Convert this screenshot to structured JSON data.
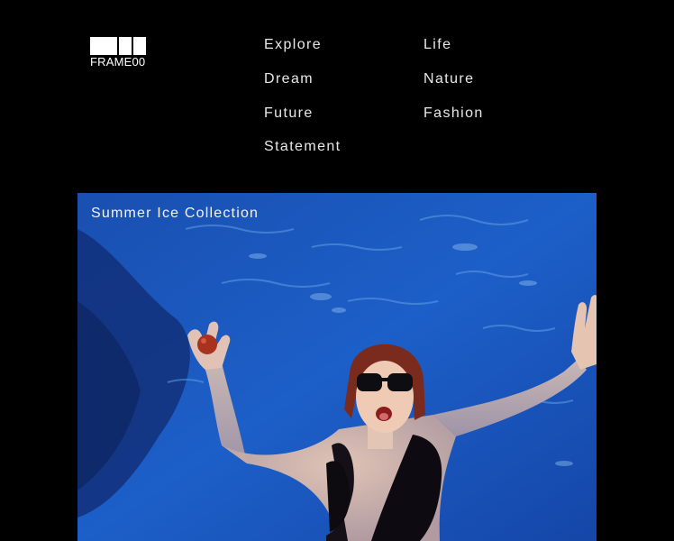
{
  "brand": {
    "logo_text": "FRAME00"
  },
  "nav": {
    "col1": [
      "Explore",
      "Dream",
      "Future",
      "Statement"
    ],
    "col2": [
      "Life",
      "Nature",
      "Fashion"
    ]
  },
  "hero": {
    "caption": "Summer Ice Collection",
    "photo_description": "woman in sunglasses floating in blue swimming pool holding a red apple"
  }
}
